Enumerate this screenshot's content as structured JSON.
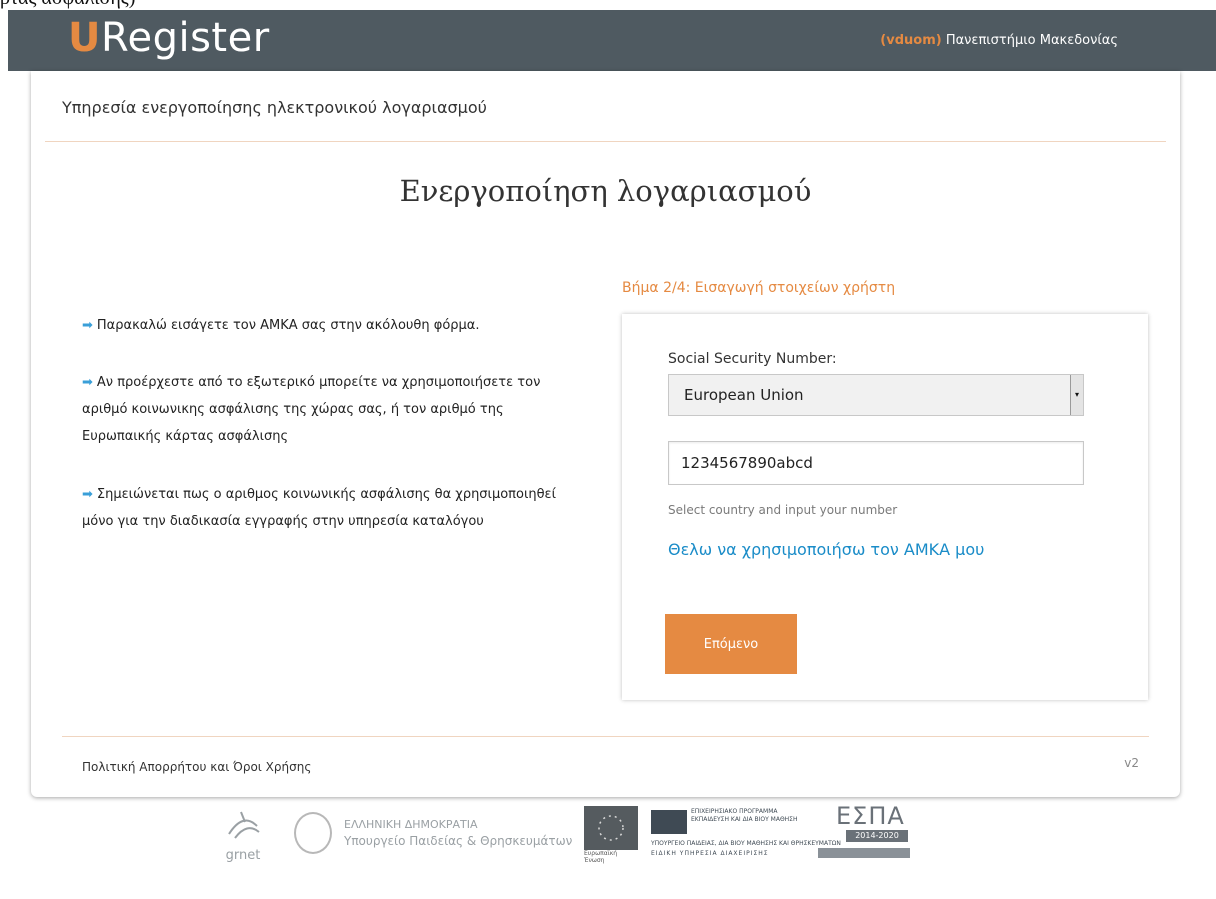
{
  "stray_text": "ρτας ασφαλισης)",
  "header": {
    "logo_letter": "U",
    "logo_rest": "Register",
    "username": "(vduom)",
    "institution": "Πανεπιστήμιο Μακεδονίας"
  },
  "service_title": "Υπηρεσία ενεργοποίησης ηλεκτρονικού λογαριασμού",
  "page_title": "Ενεργοποίηση λογαριασμού",
  "info": [
    "Παρακαλώ εισάγετε τον ΑΜΚΑ σας στην ακόλουθη φόρμα.",
    "Αν προέρχεστε από το εξωτερικό μπορείτε να χρησιμοποιήσετε τον αριθμό κοινωνικης ασφάλισης της χώρας σας, ή τον αριθμό της Ευρωπαικής κάρτας ασφάλισης",
    "Σημειώνεται πως ο αριθμος κοινωνικής ασφάλισης θα χρησιμοποιηθεί μόνο για την διαδικασία εγγραφής στην υπηρεσία καταλόγου"
  ],
  "form": {
    "step_title": "Βήμα 2/4: Εισαγωγή στοιχείων χρήστη",
    "field_label": "Social Security Number:",
    "country_select": "European Union",
    "ssn_value": "1234567890abcd",
    "help_text": "Select country and input your number",
    "amka_link": "Θελω να χρησιμοποιήσω τον ΑΜΚΑ μου",
    "next_button": "Επόμενο"
  },
  "footer": {
    "policy_link": "Πολιτική Απορρήτου και Όροι Χρήσης",
    "version": "v2"
  },
  "logos": {
    "grnet": "grnet",
    "gov_line1": "ΕΛΛΗΝΙΚΗ ΔΗΜΟΚΡΑΤΙΑ",
    "gov_line2": "Υπουργείο Παιδείας & Θρησκευμάτων",
    "eu_caption": "Ευρωπαϊκή Ένωση",
    "ep_line1": "ΕΠΙΧΕΙΡΗΣΙΑΚΟ ΠΡΟΓΡΑΜΜΑ",
    "ep_line2": "ΕΚΠΑΙΔΕΥΣΗ ΚΑΙ ΔΙΑ ΒΙΟΥ ΜΑΘΗΣΗ",
    "ep_line3": "ΥΠΟΥΡΓΕΙΟ ΠΑΙΔΕΙΑΣ, ΔΙΑ ΒΙΟΥ ΜΑΘΗΣΗΣ ΚΑΙ ΘΡΗΣΚΕΥΜΑΤΩΝ",
    "ep_line4": "ΕΙΔΙΚΗ ΥΠΗΡΕΣΙΑ ΔΙΑΧΕΙΡΙΣΗΣ",
    "espa_title": "ΕΣΠΑ",
    "espa_years": "2014-2020"
  },
  "colors": {
    "accent": "#e58a42",
    "topbar": "#4f5a61",
    "link": "#1a8cc8",
    "bullet_arrow": "#3a9fd8"
  },
  "icons": {
    "bullet": "arrow-right-icon",
    "select": "dropdown-arrow-icon"
  }
}
